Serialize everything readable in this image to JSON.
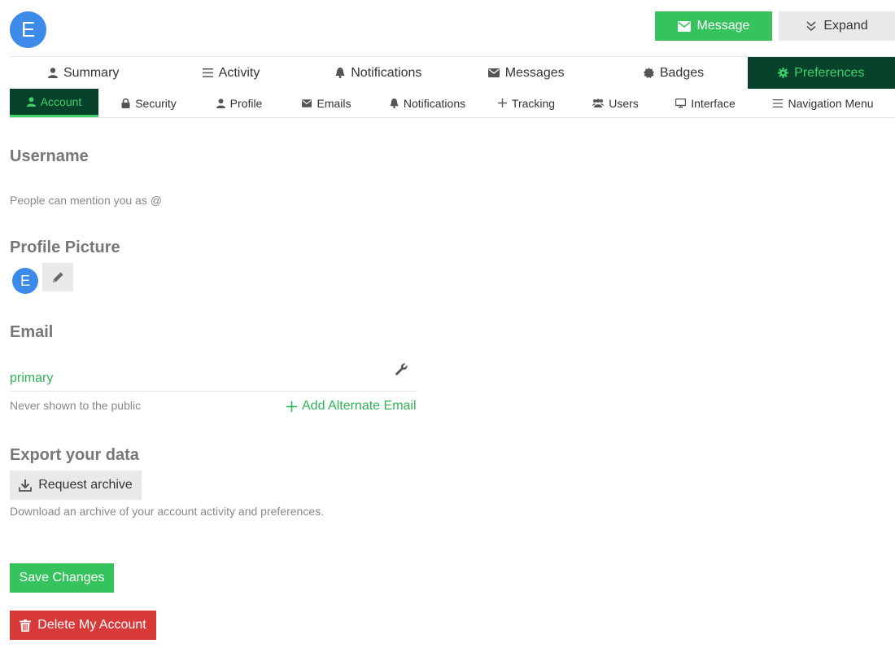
{
  "user": {
    "avatar_letter": "E"
  },
  "header": {
    "message_label": "Message",
    "expand_label": "Expand"
  },
  "primary_nav": {
    "tabs": [
      {
        "label": "Summary",
        "icon": "user-icon"
      },
      {
        "label": "Activity",
        "icon": "list-icon"
      },
      {
        "label": "Notifications",
        "icon": "bell-icon"
      },
      {
        "label": "Messages",
        "icon": "envelope-icon"
      },
      {
        "label": "Badges",
        "icon": "badge-icon"
      },
      {
        "label": "Preferences",
        "icon": "gear-icon",
        "active": true
      }
    ]
  },
  "secondary_nav": {
    "tabs": [
      {
        "label": "Account",
        "icon": "user-icon",
        "active": true
      },
      {
        "label": "Security",
        "icon": "lock-icon"
      },
      {
        "label": "Profile",
        "icon": "user-icon"
      },
      {
        "label": "Emails",
        "icon": "envelope-icon"
      },
      {
        "label": "Notifications",
        "icon": "bell-icon"
      },
      {
        "label": "Tracking",
        "icon": "plus-icon"
      },
      {
        "label": "Users",
        "icon": "users-icon"
      },
      {
        "label": "Interface",
        "icon": "monitor-icon"
      },
      {
        "label": "Navigation Menu",
        "icon": "list-icon"
      }
    ]
  },
  "username": {
    "title": "Username",
    "hint": "People can mention you as @"
  },
  "profile_picture": {
    "title": "Profile Picture"
  },
  "email": {
    "title": "Email",
    "primary_label": "primary",
    "privacy_note": "Never shown to the public",
    "add_alternate_label": "Add Alternate Email"
  },
  "export": {
    "title": "Export your data",
    "button_label": "Request archive",
    "description": "Download an archive of your account activity and preferences."
  },
  "actions": {
    "save_label": "Save Changes",
    "delete_label": "Delete My Account"
  },
  "colors": {
    "accent_green": "#36c25c",
    "active_tab_bg": "#07422b",
    "active_tab_text": "#3ed16b",
    "danger": "#d83a3a",
    "avatar_blue": "#3d8be8"
  }
}
